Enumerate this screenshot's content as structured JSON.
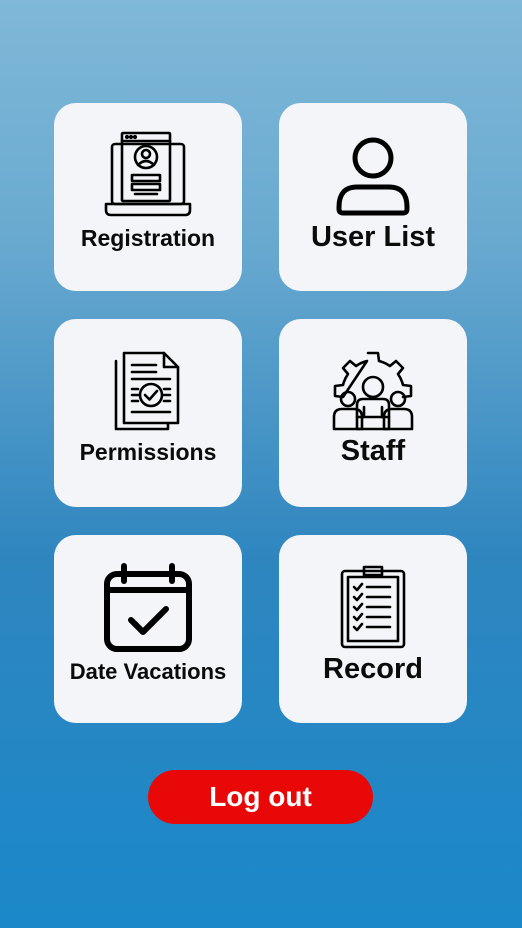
{
  "menu": {
    "tiles": [
      {
        "label": "Registration",
        "icon": "registration-laptop-icon"
      },
      {
        "label": "User List",
        "icon": "user-icon"
      },
      {
        "label": "Permissions",
        "icon": "document-check-icon"
      },
      {
        "label": "Staff",
        "icon": "staff-gear-icon"
      },
      {
        "label": "Date Vacations",
        "icon": "calendar-check-icon"
      },
      {
        "label": "Record",
        "icon": "clipboard-checklist-icon"
      }
    ]
  },
  "actions": {
    "logout_label": "Log out"
  },
  "colors": {
    "tile_background": "#f4f5f9",
    "logout_background": "#e80808",
    "logout_text": "#ffffff",
    "gradient_top": "#7fb8d8",
    "gradient_bottom": "#1a88c9"
  }
}
